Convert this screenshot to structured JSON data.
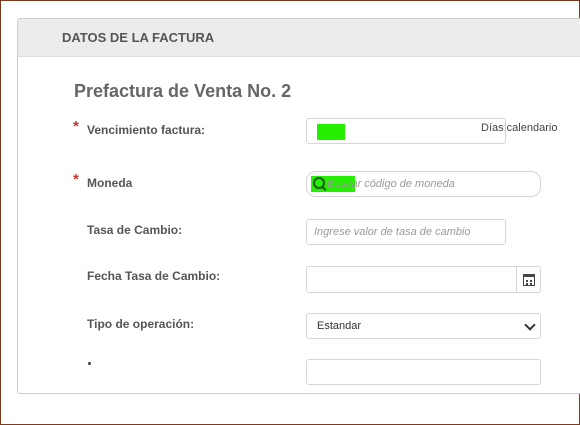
{
  "card": {
    "header_title": "DATOS DE LA FACTURA",
    "page_title": "Prefactura de Venta No. 2"
  },
  "fields": {
    "vencimiento": {
      "required_mark": "*",
      "label": "Vencimiento factura:",
      "value": "",
      "suffix": "Días calendario"
    },
    "moneda": {
      "required_mark": "*",
      "label": "Moneda",
      "placeholder": "Buscar código de moneda",
      "icon": "search-icon"
    },
    "tasa_cambio": {
      "label": "Tasa de Cambio:",
      "placeholder": "Ingrese valor de tasa de cambio"
    },
    "fecha_tasa": {
      "label": "Fecha Tasa de Cambio:",
      "value": "",
      "icon": "calendar-icon"
    },
    "tipo_operacion": {
      "label": "Tipo de operación:",
      "selected": "Estandar",
      "icon": "chevron-down-icon"
    }
  },
  "colors": {
    "required": "#c0392b",
    "highlight": "#26ee00",
    "header_bg": "#ececec",
    "outer_border": "#7a3a1e"
  }
}
